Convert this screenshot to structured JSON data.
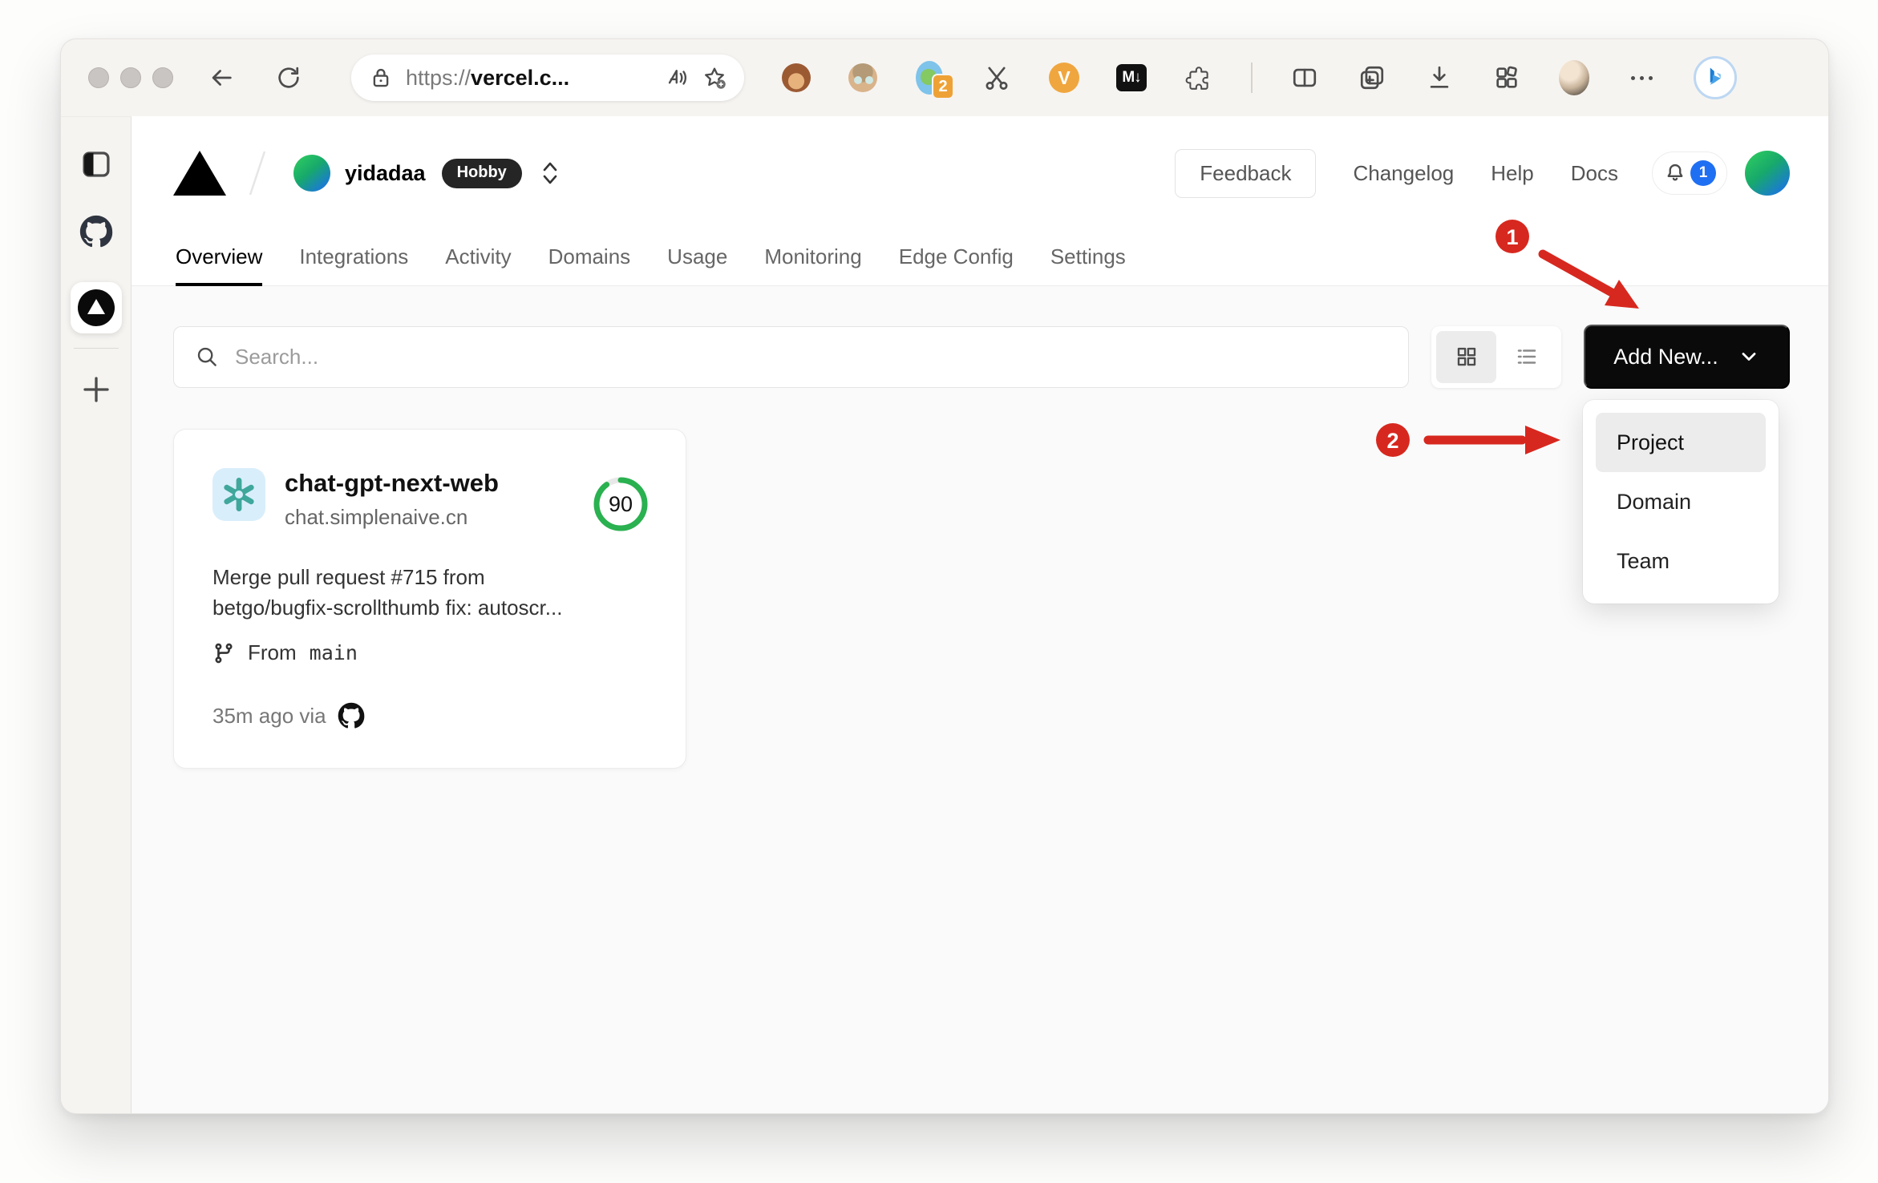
{
  "browser": {
    "url": {
      "scheme": "https://",
      "host": "vercel.c..."
    },
    "extensions": {
      "profile_badge": "2",
      "markdown_label": "M↓",
      "v_label": "V"
    }
  },
  "vercel": {
    "team": {
      "name": "yidadaa",
      "plan": "Hobby"
    },
    "header": {
      "feedback": "Feedback",
      "links": [
        {
          "label": "Changelog"
        },
        {
          "label": "Help"
        },
        {
          "label": "Docs"
        }
      ],
      "notification_count": "1"
    },
    "tabs": [
      {
        "label": "Overview"
      },
      {
        "label": "Integrations"
      },
      {
        "label": "Activity"
      },
      {
        "label": "Domains"
      },
      {
        "label": "Usage"
      },
      {
        "label": "Monitoring"
      },
      {
        "label": "Edge Config"
      },
      {
        "label": "Settings"
      }
    ],
    "toolbar": {
      "search_placeholder": "Search...",
      "add_new": "Add New..."
    },
    "dropdown": [
      {
        "label": "Project"
      },
      {
        "label": "Domain"
      },
      {
        "label": "Team"
      }
    ],
    "card": {
      "name": "chat-gpt-next-web",
      "domain": "chat.simplenaive.cn",
      "score": "90",
      "commit_line1": "Merge pull request #715 from",
      "commit_line2": "betgo/bugfix-scrollthumb fix: autoscr...",
      "from_label": "From",
      "branch": "main",
      "meta": "35m ago via"
    }
  },
  "annotations": {
    "step1": "1",
    "step2": "2"
  },
  "colors": {
    "annotation_red": "#d7281f",
    "score_green": "#2ab150",
    "notification_blue": "#1f6ff2",
    "add_new_bg": "#0a0a0a",
    "hobby_badge_bg": "#252525"
  }
}
